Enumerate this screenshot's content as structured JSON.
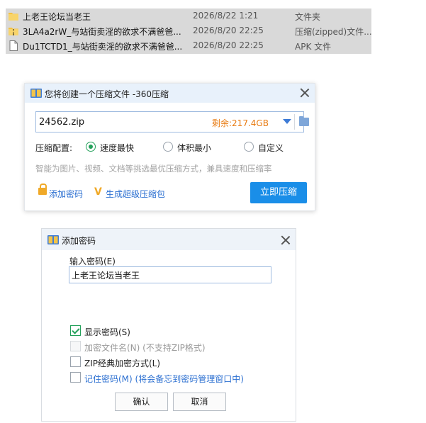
{
  "file_list": {
    "rows": [
      {
        "name": "上老王论坛当老王",
        "date": "2026/8/22 1:21",
        "type": "文件夹",
        "icon": "folder-icon"
      },
      {
        "name": "3LA4a2rW_与站街卖淫的欲求不满爸爸...",
        "date": "2026/8/20 22:25",
        "type": "压缩(zipped)文件...",
        "icon": "zip-folder-icon"
      },
      {
        "name": "Du1TCTD1_与站街卖淫的欲求不满爸爸...",
        "date": "2026/8/20 22:25",
        "type": "APK 文件",
        "icon": "file-icon"
      }
    ]
  },
  "compress_dialog": {
    "title": "您将创建一个压缩文件 -360压缩",
    "filename": "24562.zip",
    "free_space": "剩余:217.4GB",
    "config_label": "压缩配置:",
    "options": [
      "速度最快",
      "体积最小",
      "自定义"
    ],
    "selected_option": "速度最快",
    "hint": "智能为图片、视频、文档等挑选最优压缩方式，兼具速度和压缩率",
    "add_password_link": "添加密码",
    "super_archive_link": "生成超级压缩包",
    "compress_button": "立即压缩"
  },
  "password_dialog": {
    "title": "添加密码",
    "input_label": "输入密码(E)",
    "password_value": "上老王论坛当老王",
    "checkboxes": [
      {
        "label": "显示密码(S)",
        "checked": true,
        "enabled": true
      },
      {
        "label": "加密文件名(N) (不支持ZIP格式)",
        "checked": false,
        "enabled": false
      },
      {
        "label": "ZIP经典加密方式(L)",
        "checked": false,
        "enabled": true
      },
      {
        "label": "记住密码(M) (将会备忘到密码管理窗口中)",
        "checked": false,
        "enabled": true
      }
    ],
    "ok_button": "确认",
    "cancel_button": "取消"
  },
  "colors": {
    "accent_blue": "#1a8ee8",
    "link_blue": "#2b6fd1",
    "check_green": "#23a05a",
    "space_orange": "#e87b12"
  }
}
